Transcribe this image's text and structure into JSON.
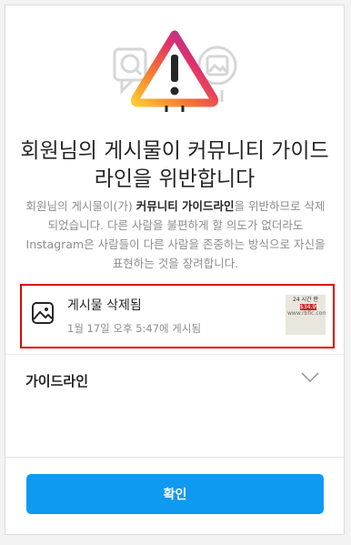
{
  "heading": {
    "title": "회원님의 게시물이 커뮤니티 가이드라인을 위반합니다"
  },
  "description": {
    "before_link": "회원님의 게시물이(가) ",
    "link": "커뮤니티 가이드라인",
    "after_link": "을 위반하므로 삭제되었습니다. 다른 사람을 불편하게 할 의도가 없더라도 Instagram은 사람들이 다른 사람을 존중하는 방식으로 자신을 표현하는 것을 장려합니다."
  },
  "post": {
    "title": "게시물 삭제됨",
    "subtitle": "1월 17일 오후 5:47에 게시됨",
    "thumbnail_text": [
      "24 시간 판",
      "$34.99",
      "www.rbfic.com"
    ]
  },
  "guidelines": {
    "label": "가이드라인"
  },
  "confirm_button": {
    "label": "확인"
  },
  "colors": {
    "accent": "#0d9af0",
    "highlight_border": "#e00000",
    "warning_gradient": [
      "#fdc830",
      "#f37335",
      "#e1306c",
      "#833ab4"
    ]
  }
}
